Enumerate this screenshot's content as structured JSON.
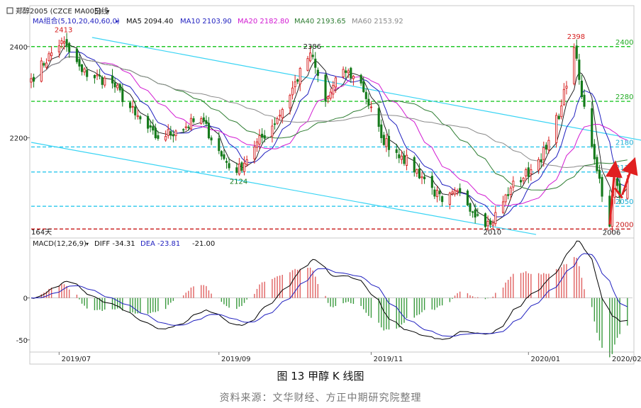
{
  "header": {
    "instrument": "郑醇2005 (CZCE MA005)",
    "period": "日线"
  },
  "ma_legend": {
    "group": "MA组合(5,10,20,40,60,0)",
    "items": [
      {
        "label": "MA5 2094.40",
        "color": "#111111"
      },
      {
        "label": "MA10 2103.90",
        "color": "#1f1fbf"
      },
      {
        "label": "MA20 2182.80",
        "color": "#d21ad2"
      },
      {
        "label": "MA40 2193.65",
        "color": "#2e7d32"
      },
      {
        "label": "MA60 2153.92",
        "color": "#8a8a8a"
      }
    ]
  },
  "macd_legend": {
    "name": "MACD(12,26,9)",
    "diff": "DIFF -34.31",
    "dea": "DEA -23.81",
    "macd": "-21.00"
  },
  "chart_data": [
    {
      "type": "candlestick",
      "title": "",
      "y_ticks": [
        "2400",
        "2200"
      ],
      "ylim": [
        1985,
        2440
      ],
      "x_ticks": [
        "2019/07",
        "2019/09",
        "2019/11",
        "2020/01",
        "2020/02"
      ],
      "x_range": [
        "2019-06-20",
        "2020-02-12"
      ],
      "levels": [
        {
          "value": 2400,
          "label": "2400",
          "style": "green-dashed"
        },
        {
          "value": 2280,
          "label": "2280",
          "style": "green-dashed"
        },
        {
          "value": 2180,
          "label": "2180",
          "style": "cyan-dashed"
        },
        {
          "value": 2125,
          "label": "2125",
          "style": "cyan-dashed"
        },
        {
          "value": 2050,
          "label": "2050",
          "style": "cyan-dashed"
        },
        {
          "value": 2000,
          "label": "2000",
          "style": "red-dashed"
        }
      ],
      "price_annotations": [
        "2413",
        "2386",
        "2124",
        "2010",
        "2398",
        "2006"
      ],
      "marker": "164天",
      "anchors": [
        {
          "date": "2019-06-20",
          "close": 2330
        },
        {
          "date": "2019-07-02",
          "close": 2413
        },
        {
          "date": "2019-07-10",
          "close": 2345
        },
        {
          "date": "2019-07-22",
          "close": 2320
        },
        {
          "date": "2019-07-31",
          "close": 2250
        },
        {
          "date": "2019-08-08",
          "close": 2200
        },
        {
          "date": "2019-08-16",
          "close": 2215
        },
        {
          "date": "2019-08-26",
          "close": 2242
        },
        {
          "date": "2019-09-03",
          "close": 2160
        },
        {
          "date": "2019-09-09",
          "close": 2124
        },
        {
          "date": "2019-09-16",
          "close": 2180
        },
        {
          "date": "2019-09-25",
          "close": 2242
        },
        {
          "date": "2019-10-08",
          "close": 2386
        },
        {
          "date": "2019-10-14",
          "close": 2280
        },
        {
          "date": "2019-10-21",
          "close": 2350
        },
        {
          "date": "2019-10-28",
          "close": 2320
        },
        {
          "date": "2019-11-05",
          "close": 2200
        },
        {
          "date": "2019-11-13",
          "close": 2160
        },
        {
          "date": "2019-11-22",
          "close": 2110
        },
        {
          "date": "2019-11-29",
          "close": 2060
        },
        {
          "date": "2019-12-06",
          "close": 2080
        },
        {
          "date": "2019-12-13",
          "close": 2030
        },
        {
          "date": "2019-12-18",
          "close": 2010
        },
        {
          "date": "2019-12-26",
          "close": 2090
        },
        {
          "date": "2020-01-03",
          "close": 2130
        },
        {
          "date": "2020-01-09",
          "close": 2175
        },
        {
          "date": "2020-01-15",
          "close": 2270
        },
        {
          "date": "2020-01-20",
          "close": 2398
        },
        {
          "date": "2020-01-23",
          "close": 2290
        },
        {
          "date": "2020-02-03",
          "close": 2006
        },
        {
          "date": "2020-02-05",
          "close": 2110
        },
        {
          "date": "2020-02-07",
          "close": 2070
        },
        {
          "date": "2020-02-10",
          "close": 2110
        }
      ],
      "arrows": [
        {
          "from": [
            "2020-02-03",
            2010
          ],
          "to": [
            "2020-02-05",
            2132
          ],
          "color": "#e02020"
        },
        {
          "from": [
            "2020-02-05",
            2090
          ],
          "to": [
            "2020-02-08",
            2068
          ],
          "color": "#e02020"
        },
        {
          "from": [
            "2020-02-08",
            2075
          ],
          "to": [
            "2020-02-12",
            2140
          ],
          "color": "#e02020"
        }
      ],
      "channel_lines": [
        {
          "from": [
            "2019-07-14",
            2420
          ],
          "to": [
            "2020-02-20",
            2190
          ],
          "color": "#39d4f4"
        },
        {
          "from": [
            "2019-06-20",
            2190
          ],
          "to": [
            "2020-01-05",
            1988
          ],
          "color": "#39d4f4"
        }
      ]
    },
    {
      "type": "macd",
      "title": "",
      "y_ticks": [
        "0",
        "-50"
      ],
      "ylim": [
        -62,
        58
      ],
      "series": [
        {
          "name": "DIFF",
          "color": "#000000"
        },
        {
          "name": "DEA",
          "color": "#1f1fbf"
        }
      ]
    }
  ],
  "caption": "图 13  甲醇 K 线图",
  "source": "资料来源：文华财经、方正中期研究院整理"
}
